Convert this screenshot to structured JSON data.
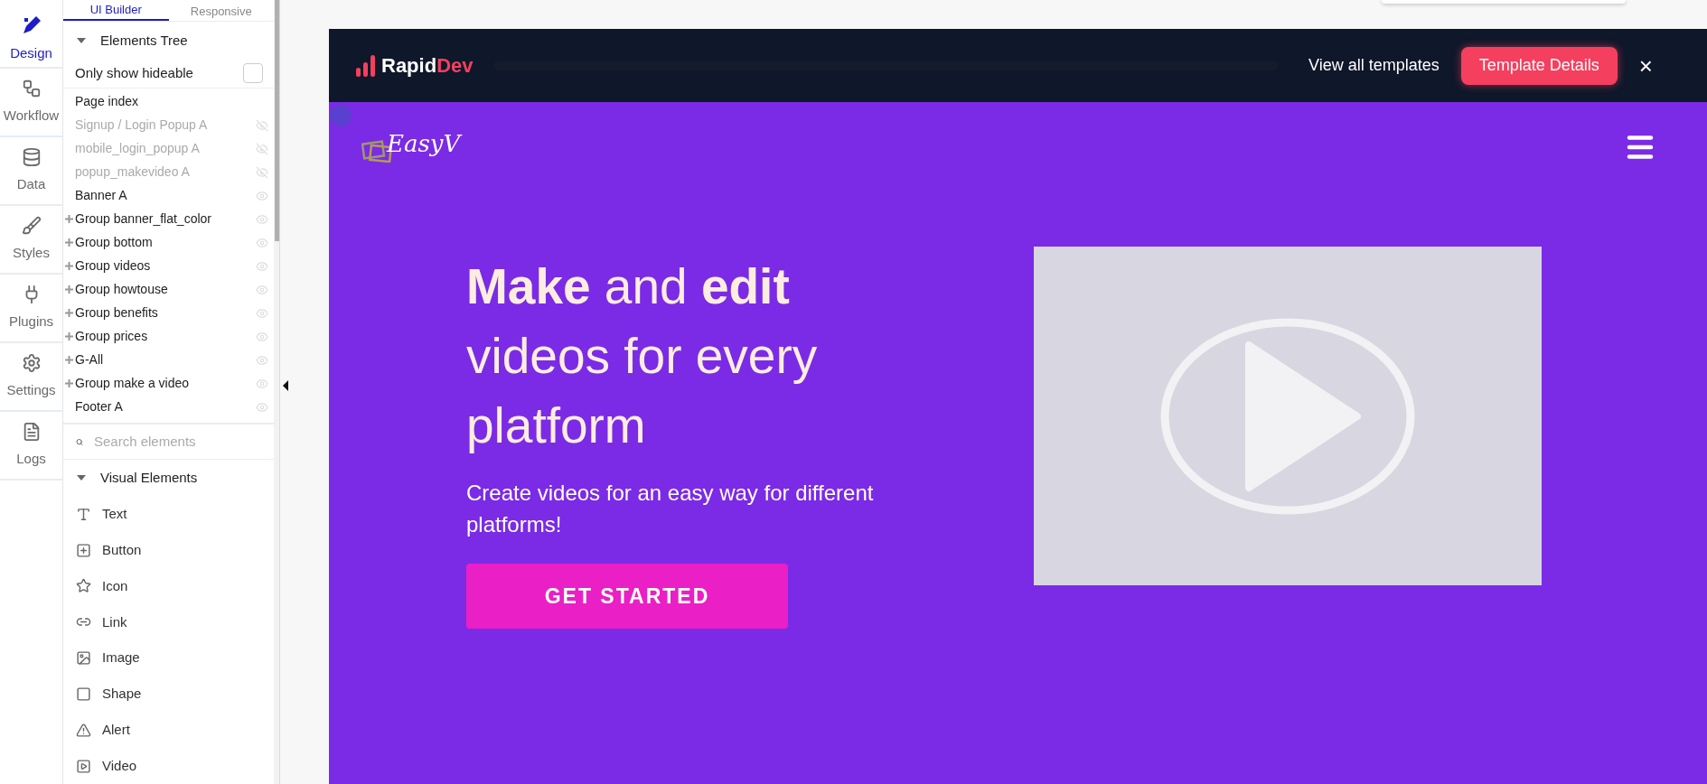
{
  "rail": [
    {
      "label": "Design",
      "selected": true
    },
    {
      "label": "Workflow",
      "selected": false
    },
    {
      "label": "Data",
      "selected": false
    },
    {
      "label": "Styles",
      "selected": false
    },
    {
      "label": "Plugins",
      "selected": false
    },
    {
      "label": "Settings",
      "selected": false
    },
    {
      "label": "Logs",
      "selected": false
    }
  ],
  "tabs": [
    {
      "label": "UI Builder",
      "selected": true
    },
    {
      "label": "Responsive",
      "selected": false
    }
  ],
  "tree": {
    "title": "Elements Tree",
    "expanded": true,
    "filter": {
      "label": "Only show hideable",
      "checked": false
    },
    "items": [
      {
        "label": "Page index",
        "kind": "page",
        "hidden": false,
        "has_children": false
      },
      {
        "label": "Signup / Login Popup A",
        "kind": "element",
        "hidden": true,
        "has_children": false
      },
      {
        "label": "mobile_login_popup A",
        "kind": "element",
        "hidden": true,
        "has_children": false
      },
      {
        "label": "popup_makevideo A",
        "kind": "element",
        "hidden": true,
        "has_children": false
      },
      {
        "label": "Banner A",
        "kind": "element",
        "hidden": false,
        "has_children": false
      },
      {
        "label": "Group banner_flat_color",
        "kind": "element",
        "hidden": false,
        "has_children": true
      },
      {
        "label": "Group bottom",
        "kind": "element",
        "hidden": false,
        "has_children": true
      },
      {
        "label": "Group videos",
        "kind": "element",
        "hidden": false,
        "has_children": true
      },
      {
        "label": "Group howtouse",
        "kind": "element",
        "hidden": false,
        "has_children": true
      },
      {
        "label": "Group benefits",
        "kind": "element",
        "hidden": false,
        "has_children": true
      },
      {
        "label": "Group prices",
        "kind": "element",
        "hidden": false,
        "has_children": true
      },
      {
        "label": "G-All",
        "kind": "element",
        "hidden": false,
        "has_children": true
      },
      {
        "label": "Group make a video",
        "kind": "element",
        "hidden": false,
        "has_children": true
      },
      {
        "label": "Footer A",
        "kind": "element",
        "hidden": false,
        "has_children": false
      }
    ]
  },
  "search": {
    "placeholder": "Search elements"
  },
  "palette": {
    "title": "Visual Elements",
    "expanded": true,
    "items": [
      "Text",
      "Button",
      "Icon",
      "Link",
      "Image",
      "Shape",
      "Alert",
      "Video"
    ]
  },
  "preview": {
    "header": {
      "logo_first": "Rapid",
      "logo_second": "Dev",
      "link": "View all templates",
      "button": "Template Details",
      "close": "×"
    },
    "brand": "EasyV",
    "title": "**Make** and **edit** videos for every platform",
    "subtitle": "Create videos for an easy way for different platforms!",
    "cta": "GET STARTED"
  }
}
